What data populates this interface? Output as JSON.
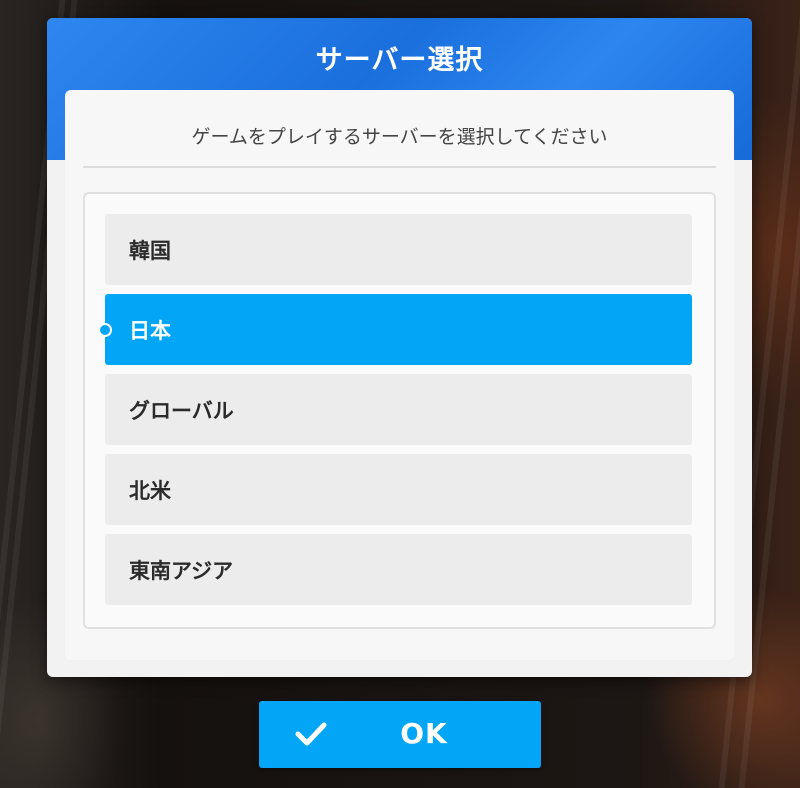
{
  "dialog": {
    "title": "サーバー選択",
    "subtitle": "ゲームをプレイするサーバーを選択してください",
    "accent_color": "#1a6fdd",
    "selected_color": "#03a6f7",
    "selected_index": 1
  },
  "servers": [
    {
      "label": "韓国",
      "selected": false
    },
    {
      "label": "日本",
      "selected": true
    },
    {
      "label": "グローバル",
      "selected": false
    },
    {
      "label": "北米",
      "selected": false
    },
    {
      "label": "東南アジア",
      "selected": false
    }
  ],
  "ok_button": {
    "label": "OK",
    "icon": "checkmark-icon"
  }
}
